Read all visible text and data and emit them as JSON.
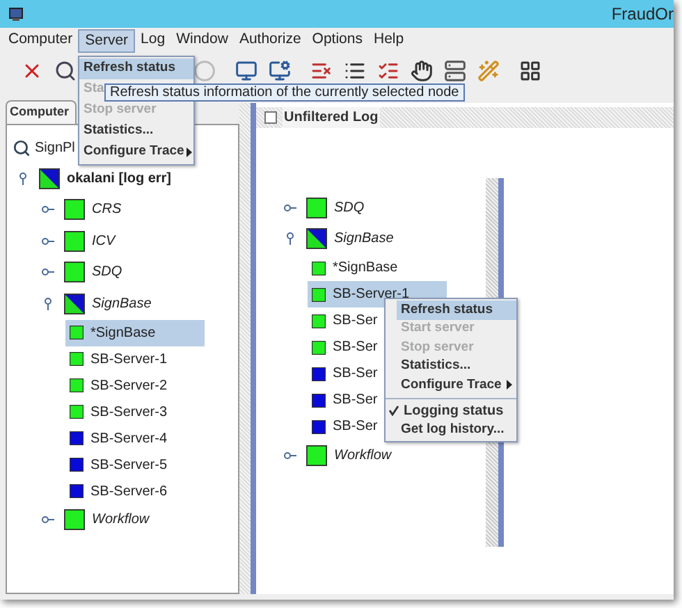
{
  "window": {
    "title": "FraudOr"
  },
  "menu_bar": [
    {
      "label": "Computer",
      "selected": false
    },
    {
      "label": "Server",
      "selected": true
    },
    {
      "label": "Log",
      "selected": false
    },
    {
      "label": "Window",
      "selected": false
    },
    {
      "label": "Authorize",
      "selected": false
    },
    {
      "label": "Options",
      "selected": false
    },
    {
      "label": "Help",
      "selected": false
    }
  ],
  "server_menu": [
    {
      "label": "Refresh status",
      "selected": true,
      "disabled": false,
      "submenu": false
    },
    {
      "label": "Sta",
      "selected": false,
      "disabled": true,
      "submenu": false
    },
    {
      "label": "Stop server",
      "selected": false,
      "disabled": true,
      "submenu": false
    },
    {
      "label": "Statistics...",
      "selected": false,
      "disabled": false,
      "submenu": false
    },
    {
      "label": "Configure Trace",
      "selected": false,
      "disabled": false,
      "submenu": true
    }
  ],
  "tooltip": "Refresh status information of the currently selected node",
  "left_panel": {
    "tab": "Computer",
    "root": "SignPl",
    "tree": [
      {
        "kind": "host",
        "label": "okalani [log err]",
        "color": "#1010c8",
        "partial": true,
        "expanded": true,
        "selected": false,
        "children": [
          {
            "kind": "group",
            "label": "CRS",
            "color": "#22ee22",
            "partial": false,
            "expanded": false,
            "selected": false
          },
          {
            "kind": "group",
            "label": "ICV",
            "color": "#22ee22",
            "partial": false,
            "expanded": false,
            "selected": false
          },
          {
            "kind": "group",
            "label": "SDQ",
            "color": "#22ee22",
            "partial": false,
            "expanded": false,
            "selected": false
          },
          {
            "kind": "group",
            "label": "SignBase",
            "color": "#1010c8",
            "partial": true,
            "expanded": true,
            "selected": false,
            "children": [
              {
                "kind": "server",
                "label": "*SignBase",
                "color": "#22ee22",
                "partial": false,
                "selected": true
              },
              {
                "kind": "server",
                "label": "SB-Server-1",
                "color": "#22ee22",
                "partial": false,
                "selected": false
              },
              {
                "kind": "server",
                "label": "SB-Server-2",
                "color": "#22ee22",
                "partial": false,
                "selected": false
              },
              {
                "kind": "server",
                "label": "SB-Server-3",
                "color": "#22ee22",
                "partial": false,
                "selected": false
              },
              {
                "kind": "server",
                "label": "SB-Server-4",
                "color": "#0a0ad8",
                "partial": false,
                "selected": false
              },
              {
                "kind": "server",
                "label": "SB-Server-5",
                "color": "#0a0ad8",
                "partial": false,
                "selected": false
              },
              {
                "kind": "server",
                "label": "SB-Server-6",
                "color": "#0a0ad8",
                "partial": false,
                "selected": false
              }
            ]
          },
          {
            "kind": "group",
            "label": "Workflow",
            "color": "#22ee22",
            "partial": false,
            "expanded": false,
            "selected": false
          }
        ]
      }
    ]
  },
  "right_panel": {
    "header": "Unfiltered Log",
    "header_checked": false,
    "tree": [
      {
        "kind": "group",
        "label": "SDQ",
        "color": "#22ee22",
        "partial": false,
        "expanded": false,
        "selected": false
      },
      {
        "kind": "group",
        "label": "SignBase",
        "color": "#1010c8",
        "partial": true,
        "expanded": true,
        "selected": false,
        "children": [
          {
            "kind": "server",
            "label": "*SignBase",
            "color": "#22ee22",
            "partial": false,
            "selected": false
          },
          {
            "kind": "server",
            "label": "SB-Server-1",
            "color": "#22ee22",
            "partial": false,
            "selected": true
          },
          {
            "kind": "server",
            "label": "SB-Ser",
            "color": "#22ee22",
            "partial": false,
            "selected": false
          },
          {
            "kind": "server",
            "label": "SB-Ser",
            "color": "#22ee22",
            "partial": false,
            "selected": false
          },
          {
            "kind": "server",
            "label": "SB-Ser",
            "color": "#0a0ad8",
            "partial": false,
            "selected": false
          },
          {
            "kind": "server",
            "label": "SB-Ser",
            "color": "#0a0ad8",
            "partial": false,
            "selected": false
          },
          {
            "kind": "server",
            "label": "SB-Ser",
            "color": "#0a0ad8",
            "partial": false,
            "selected": false
          }
        ]
      },
      {
        "kind": "group",
        "label": "Workflow",
        "color": "#22ee22",
        "partial": false,
        "expanded": false,
        "selected": false
      }
    ]
  },
  "context_menu": [
    {
      "kind": "item",
      "label": "Refresh status",
      "selected": true,
      "disabled": false,
      "submenu": false
    },
    {
      "kind": "item",
      "label": "Start server",
      "selected": false,
      "disabled": true,
      "submenu": false
    },
    {
      "kind": "item",
      "label": "Stop server",
      "selected": false,
      "disabled": true,
      "submenu": false
    },
    {
      "kind": "item",
      "label": "Statistics...",
      "selected": false,
      "disabled": false,
      "submenu": false
    },
    {
      "kind": "item",
      "label": "Configure Trace",
      "selected": false,
      "disabled": false,
      "submenu": true
    },
    {
      "kind": "separator"
    },
    {
      "kind": "check",
      "label": "Logging status",
      "checked": true
    },
    {
      "kind": "item",
      "label": "Get log history...",
      "selected": false,
      "disabled": false,
      "submenu": false
    }
  ]
}
